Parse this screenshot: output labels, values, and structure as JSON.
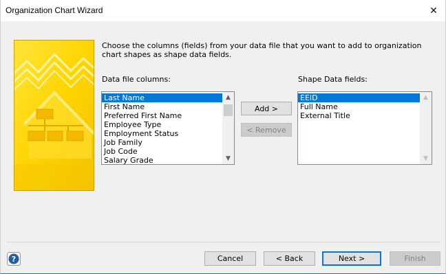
{
  "window": {
    "title": "Organization Chart Wizard",
    "close_glyph": "✕"
  },
  "instructions": "Choose the columns (fields) from your data file that you want to add to organization chart shapes as shape data fields.",
  "data_file_columns": {
    "label": "Data file columns:",
    "items": [
      "Last Name",
      "First Name",
      "Preferred First Name",
      "Employee Type",
      "Employment Status",
      "Job Family",
      "Job Code",
      "Salary Grade"
    ],
    "selected": "Last Name"
  },
  "shape_data_fields": {
    "label": "Shape Data fields:",
    "items": [
      "EEID",
      "Full Name",
      "External Title"
    ],
    "selected": "EEID"
  },
  "buttons": {
    "add": "Add >",
    "remove": "< Remove",
    "cancel": "Cancel",
    "back": "< Back",
    "next": "Next >",
    "finish": "Finish"
  },
  "icons": {
    "help": "help-icon",
    "close": "close-icon",
    "scroll_up": "chevron-up-icon",
    "scroll_down": "chevron-down-icon"
  },
  "colors": {
    "selection": "#0078d7",
    "banner": "#ffd500",
    "help_icon": "#1f5f9c"
  }
}
